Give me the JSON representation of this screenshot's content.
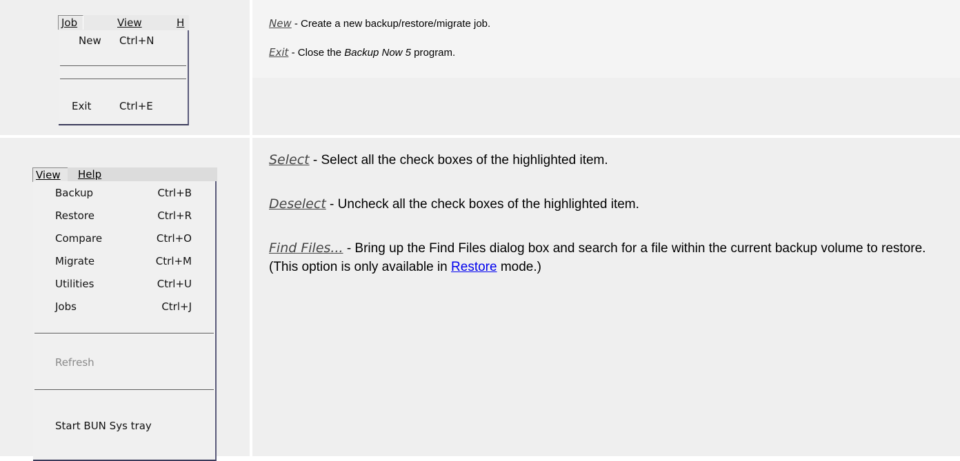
{
  "job_menu": {
    "bar": [
      "Job",
      "View",
      "H"
    ],
    "items": [
      {
        "label": "New",
        "shortcut": "Ctrl+N"
      },
      {
        "label": "Exit",
        "shortcut": "Ctrl+E"
      }
    ]
  },
  "job_desc": [
    {
      "term": "New",
      "text": " - Create a new backup/restore/migrate job."
    },
    {
      "term": "Exit",
      "pre": " - Close the ",
      "emph": "Backup Now 5",
      "post": " program."
    }
  ],
  "view_menu": {
    "bar": [
      "View",
      "Help"
    ],
    "items": [
      {
        "label": "Backup",
        "shortcut": "Ctrl+B"
      },
      {
        "label": "Restore",
        "shortcut": "Ctrl+R"
      },
      {
        "label": "Compare",
        "shortcut": "Ctrl+O"
      },
      {
        "label": "Migrate",
        "shortcut": "Ctrl+M"
      },
      {
        "label": "Utilities",
        "shortcut": "Ctrl+U"
      },
      {
        "label": "Jobs",
        "shortcut": "Ctrl+J"
      }
    ],
    "refresh": "Refresh",
    "sys_tray": "Start BUN Sys tray"
  },
  "view_desc": [
    {
      "term": "Select",
      "text": " - Select all the check boxes of the highlighted item."
    },
    {
      "term": "Deselect",
      "text": " - Uncheck all the check boxes of the highlighted item."
    },
    {
      "term": "Find Files...",
      "pre": " - Bring up the Find Files dialog box and search for a file within the current backup volume to restore. (This option is only available in ",
      "link": "Restore",
      "post": " mode.)"
    }
  ]
}
